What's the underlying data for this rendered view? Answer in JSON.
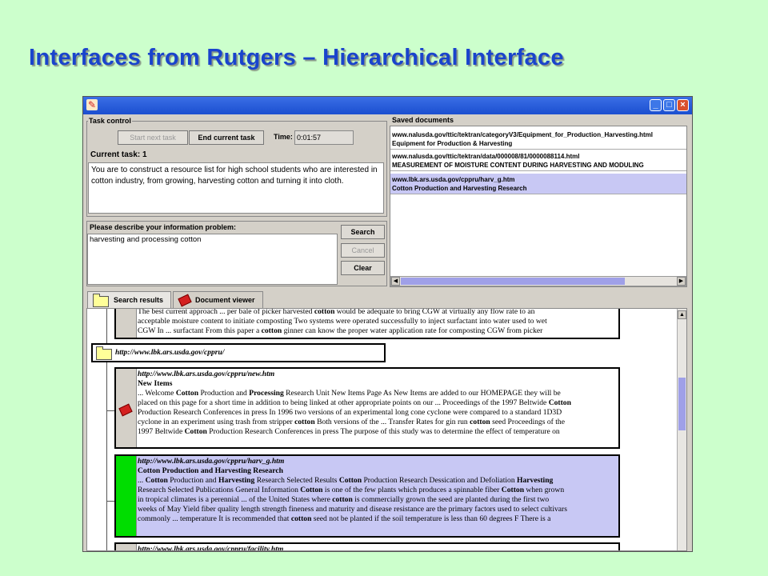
{
  "slide_title": "Interfaces from Rutgers – Hierarchical Interface",
  "window": {
    "controls": {
      "minimize": "_",
      "maximize": "□",
      "close": "×"
    }
  },
  "task_control": {
    "label": "Task control",
    "start_button": "Start next task",
    "end_button": "End current task",
    "time_label": "Time:",
    "time_value": "0:01:57",
    "current_task": "Current task: 1",
    "task_text": "You are to construct a resource list for high school students who are interested in cotton industry, from growing, harvesting cotton and turning it into cloth."
  },
  "info_problem": {
    "label": "Please describe your information problem:",
    "query": "harvesting and processing cotton",
    "search_button": "Search",
    "cancel_button": "Cancel",
    "clear_button": "Clear"
  },
  "saved_documents": {
    "label": "Saved documents",
    "items": [
      {
        "url": "www.nalusda.gov/ttic/tektran/categoryV3/Equipment_for_Production_Harvesting.html",
        "title": "Equipment for Production & Harvesting"
      },
      {
        "url": "www.nalusda.gov/ttic/tektran/data/000008/81/0000088114.html",
        "title": "MEASUREMENT OF MOISTURE CONTENT DURING HARVESTING AND MODULING"
      },
      {
        "url": "www.lbk.ars.usda.gov/cppru/harv_g.htm",
        "title": "Cotton Production and Harvesting Research"
      }
    ]
  },
  "tabs": [
    {
      "label": "Search results"
    },
    {
      "label": "Document viewer"
    }
  ],
  "results": {
    "top_snippet": {
      "lines": [
        "The best current approach ... per bale of picker harvested cotton would be adequate to bring CGW at virtually any flow rate to an",
        "acceptable moisture content to initiate composting Two systems were operated successfully to inject surfactant into water used to wet",
        "CGW In ... surfactant From this paper a cotton ginner can know the proper water application rate for composting CGW from picker"
      ]
    },
    "site_url": "http://www.lbk.ars.usda.gov/cppru/",
    "docs": [
      {
        "url": "http://www.lbk.ars.usda.gov/cppru/new.htm",
        "title": "New Items",
        "lines": [
          "... Welcome Cotton Production and Processing Research Unit New Items Page As New Items are added to our HOMEPAGE they will be",
          "placed on this page for a short time in addition to being linked at other appropriate points on our ... Proceedings of the 1997 Beltwide Cotton",
          "Production Research Conferences in press In 1996 two versions of an experimental long cone cyclone were compared to a standard 1D3D",
          "cyclone in an experiment using trash from stripper cotton Both versions of the ... Transfer Rates for gin run cotton seed Proceedings of the",
          "1997 Beltwide Cotton Production Research Conferences in press The purpose of this study was to determine the effect of temperature on"
        ]
      },
      {
        "url": "http://www.lbk.ars.usda.gov/cppru/harv_g.htm",
        "title": "Cotton Production and Harvesting Research",
        "lines": [
          "... Cotton Production and Harvesting Research Selected Results Cotton Production Research Dessication and Defoliation Harvesting",
          "Research Selected Publications General Information Cotton is one of the few plants which produces a spinnable fiber Cotton when grown",
          "in tropical climates is a perennial ... of the United States where cotton is commercially grown the seed are planted during the first two",
          "weeks of May Yield fiber quality length strength fineness and maturity and disease resistance are the primary factors used to select cultivars",
          "commonly ... temperature It is recommended that cotton seed not be planted if the soil temperature is less than 60 degrees F There is a"
        ]
      }
    ],
    "bottom_url": "http://www.lbk.ars.usda.gov/cppru/facility.htm"
  },
  "colors": {
    "title": "#1a44cc",
    "background": "#ccffcc",
    "selected": "#c8c8f4",
    "saved_marker": "#00dd00"
  }
}
